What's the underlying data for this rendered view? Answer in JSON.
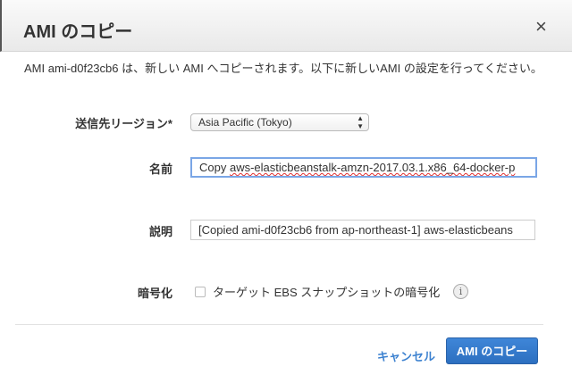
{
  "dialog": {
    "title": "AMI のコピー",
    "close_icon": "×",
    "description": "AMI ami-d0f23cb6 は、新しい AMI へコピーされます。以下に新しいAMI の設定を行ってください。"
  },
  "form": {
    "region": {
      "label": "送信先リージョン*",
      "value": "Asia Pacific (Tokyo)",
      "arrows": "▲▼"
    },
    "name": {
      "label": "名前",
      "prefix": "Copy ",
      "value": "aws-elasticbeanstalk-amzn-2017.03.1.x86_64-docker-p"
    },
    "description": {
      "label": "説明",
      "value": "[Copied ami-d0f23cb6 from ap-northeast-1] aws-elasticbeans"
    },
    "encryption": {
      "label": "暗号化",
      "checkbox_label": "ターゲット EBS スナップショットの暗号化",
      "checked": false,
      "info_icon": "i"
    }
  },
  "footer": {
    "cancel_label": "キャンセル",
    "copy_label": "AMI のコピー"
  }
}
